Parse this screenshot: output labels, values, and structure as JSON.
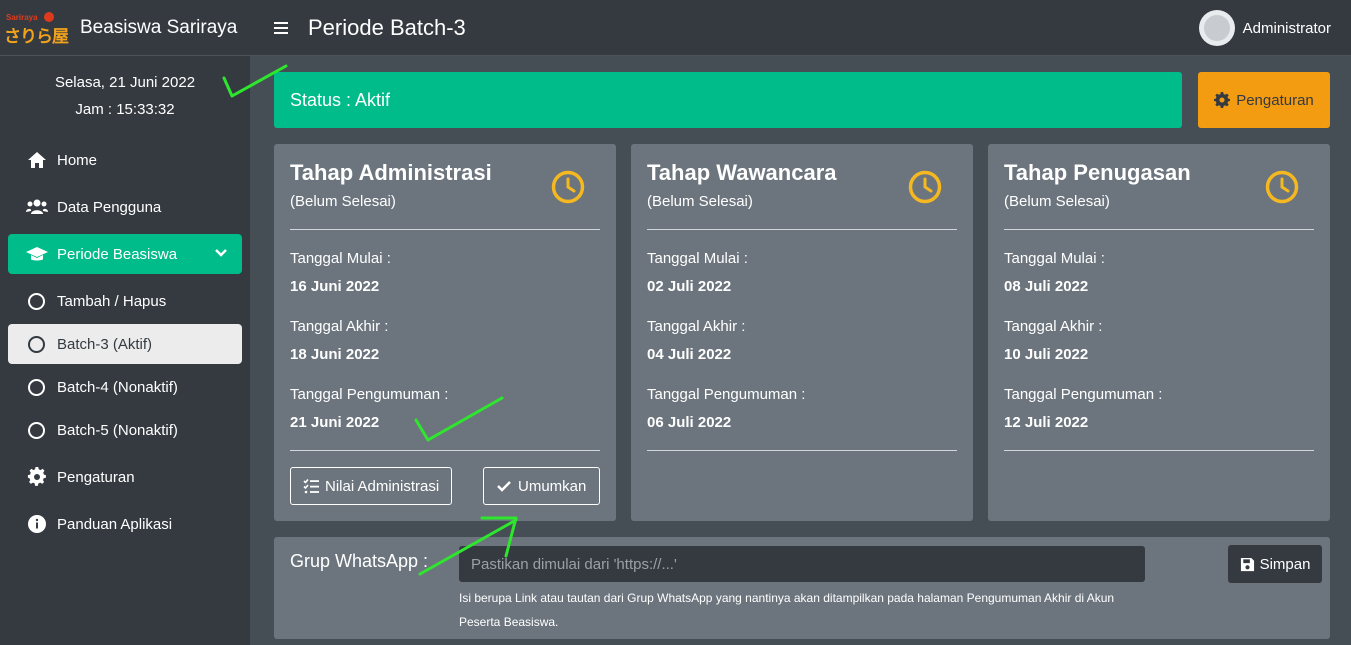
{
  "app": {
    "brand_name": "Beasiswa Sariraya",
    "logo_top": "Sariraya",
    "logo_main": "さりら屋"
  },
  "clock": {
    "date": "Selasa, 21 Juni 2022",
    "time": "Jam : 15:33:32"
  },
  "sidebar": {
    "items": [
      {
        "label": "Home",
        "icon": "home-icon"
      },
      {
        "label": "Data Pengguna",
        "icon": "users-icon"
      },
      {
        "label": "Periode Beasiswa",
        "icon": "graduation-cap-icon"
      },
      {
        "label": "Pengaturan",
        "icon": "gear-icon"
      },
      {
        "label": "Panduan Aplikasi",
        "icon": "info-icon"
      }
    ],
    "subitems": [
      {
        "label": "Tambah / Hapus"
      },
      {
        "label": "Batch-3 (Aktif)"
      },
      {
        "label": "Batch-4 (Nonaktif)"
      },
      {
        "label": "Batch-5 (Nonaktif)"
      }
    ]
  },
  "header": {
    "title": "Periode Batch-3",
    "user": "Administrator"
  },
  "status": {
    "text": "Status : Aktif",
    "settings_button": "Pengaturan",
    "color": "#00bb8a",
    "settings_color": "#f39c12"
  },
  "cards": [
    {
      "title": "Tahap Administrasi",
      "subtitle": "(Belum Selesai)",
      "start_label": "Tanggal Mulai :",
      "start_value": "16 Juni 2022",
      "end_label": "Tanggal Akhir :",
      "end_value": "18 Juni 2022",
      "announce_label": "Tanggal Pengumuman :",
      "announce_value": "21 Juni 2022",
      "button_scores": "Nilai Administrasi",
      "button_announce": "Umumkan"
    },
    {
      "title": "Tahap Wawancara",
      "subtitle": "(Belum Selesai)",
      "start_label": "Tanggal Mulai :",
      "start_value": "02 Juli 2022",
      "end_label": "Tanggal Akhir :",
      "end_value": "04 Juli 2022",
      "announce_label": "Tanggal Pengumuman :",
      "announce_value": "06 Juli 2022"
    },
    {
      "title": "Tahap Penugasan",
      "subtitle": "(Belum Selesai)",
      "start_label": "Tanggal Mulai :",
      "start_value": "08 Juli 2022",
      "end_label": "Tanggal Akhir :",
      "end_value": "10 Juli 2022",
      "announce_label": "Tanggal Pengumuman :",
      "announce_value": "12 Juli 2022"
    }
  ],
  "whatsapp": {
    "label": "Grup WhatsApp :",
    "placeholder": "Pastikan dimulai dari 'https://...'",
    "help": "Isi berupa Link atau tautan dari Grup WhatsApp yang nantinya akan ditampilkan pada halaman Pengumuman Akhir di Akun Peserta Beasiswa.",
    "save_button": "Simpan"
  }
}
